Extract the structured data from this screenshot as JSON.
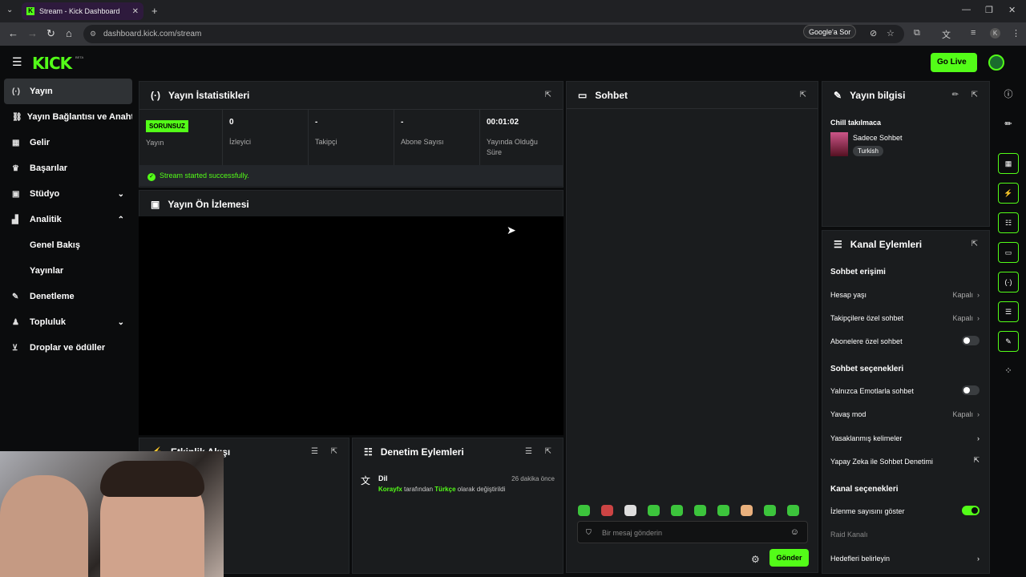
{
  "browser": {
    "tab_title": "Stream - Kick Dashboard",
    "url": "dashboard.kick.com/stream",
    "google_sor": "Google'a Sor",
    "profile_initial": "K"
  },
  "header": {
    "logo": "KICK",
    "beta": "BETA",
    "go_live": "Go Live"
  },
  "sidebar": {
    "items": [
      {
        "label": "Yayın"
      },
      {
        "label": "Yayın Bağlantısı ve Anahtarı"
      },
      {
        "label": "Gelir"
      },
      {
        "label": "Başarılar"
      },
      {
        "label": "Stüdyo"
      },
      {
        "label": "Analitik"
      },
      {
        "label": "Genel Bakış"
      },
      {
        "label": "Yayınlar"
      },
      {
        "label": "Denetleme"
      },
      {
        "label": "Topluluk"
      },
      {
        "label": "Droplar ve ödüller"
      }
    ]
  },
  "stats_panel": {
    "title": "Yayın İstatistikleri",
    "status_badge": "SORUNSUZ",
    "cols": [
      {
        "value": "",
        "label": "Yayın"
      },
      {
        "value": "0",
        "label": "İzleyici"
      },
      {
        "value": "-",
        "label": "Takipçi"
      },
      {
        "value": "-",
        "label": "Abone Sayısı"
      },
      {
        "value": "00:01:02",
        "label": "Yayında Olduğu Süre"
      }
    ],
    "success_msg": "Stream started successfully."
  },
  "preview_panel": {
    "title": "Yayın Ön İzlemesi"
  },
  "activity_panel": {
    "title": "Etkinlik Akışı"
  },
  "moderation_panel": {
    "title": "Denetim Eylemleri",
    "entry_title": "Dil",
    "entry_time": "26 dakika önce",
    "entry_user": "Korayfx",
    "entry_mid": "tarafından",
    "entry_lang": "Türkçe",
    "entry_tail": "olarak değiştirildi"
  },
  "chat": {
    "title": "Sohbet",
    "placeholder": "Bir mesaj gönderin",
    "send": "Gönder"
  },
  "info_panel": {
    "title": "Yayın bilgisi",
    "stream_title": "Chill takılmaca",
    "category": "Sadece Sohbet",
    "tag": "Turkish"
  },
  "channel_actions": {
    "title": "Kanal Eylemleri",
    "chat_access": "Sohbet erişimi",
    "account_age": "Hesap yaşı",
    "account_age_val": "Kapalı",
    "followers_only": "Takipçilere özel sohbet",
    "followers_only_val": "Kapalı",
    "subs_only": "Abonelere özel sohbet",
    "chat_options": "Sohbet seçenekleri",
    "emote_only": "Yalnızca Emotlarla sohbet",
    "slow_mode": "Yavaş mod",
    "slow_mode_val": "Kapalı",
    "banned_words": "Yasaklanmış kelimeler",
    "ai_moderation": "Yapay Zeka ile Sohbet Denetimi",
    "channel_options": "Kanal seçenekleri",
    "show_viewers": "İzlenme sayısını göster",
    "raid_channel": "Raid Kanalı",
    "set_goals": "Hedefleri belirleyin"
  },
  "colors": {
    "accent": "#53fc18",
    "panel": "#1a1c1e",
    "bg": "#0b0c0d"
  }
}
